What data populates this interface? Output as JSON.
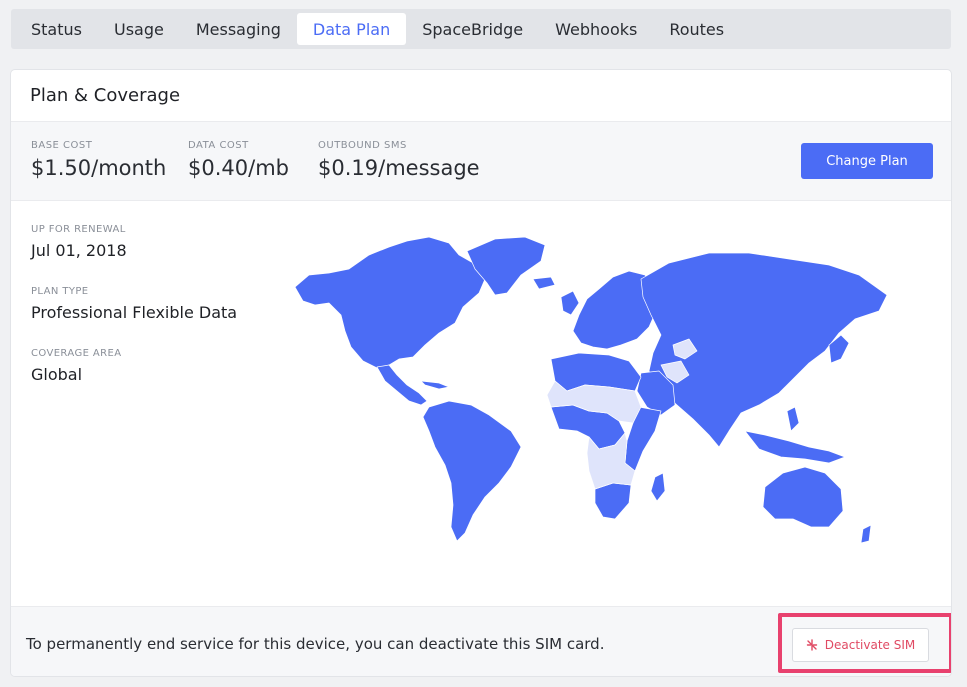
{
  "tabs": [
    {
      "label": "Status"
    },
    {
      "label": "Usage"
    },
    {
      "label": "Messaging"
    },
    {
      "label": "Data Plan",
      "active": true
    },
    {
      "label": "SpaceBridge"
    },
    {
      "label": "Webhooks"
    },
    {
      "label": "Routes"
    }
  ],
  "card": {
    "title": "Plan & Coverage",
    "costs": {
      "base": {
        "label": "BASE COST",
        "value": "$1.50/month"
      },
      "data": {
        "label": "DATA COST",
        "value": "$0.40/mb"
      },
      "sms": {
        "label": "OUTBOUND SMS",
        "value": "$0.19/message"
      }
    },
    "change_plan_label": "Change Plan",
    "renewal": {
      "label": "UP FOR RENEWAL",
      "value": "Jul 01, 2018"
    },
    "plan_type": {
      "label": "PLAN TYPE",
      "value": "Professional Flexible Data"
    },
    "coverage": {
      "label": "COVERAGE AREA",
      "value": "Global"
    },
    "map": {
      "covered_color": "#4b6cf5",
      "uncovered_color": "#dfe4fb"
    },
    "footer": {
      "text": "To permanently end service for this device, you can deactivate this SIM card.",
      "deactivate_label": "Deactivate SIM",
      "deactivate_icon": "sim-off-icon",
      "highlight_color": "#e8416e"
    }
  },
  "colors": {
    "accent": "#4b6cf5",
    "danger": "#e04a63"
  }
}
